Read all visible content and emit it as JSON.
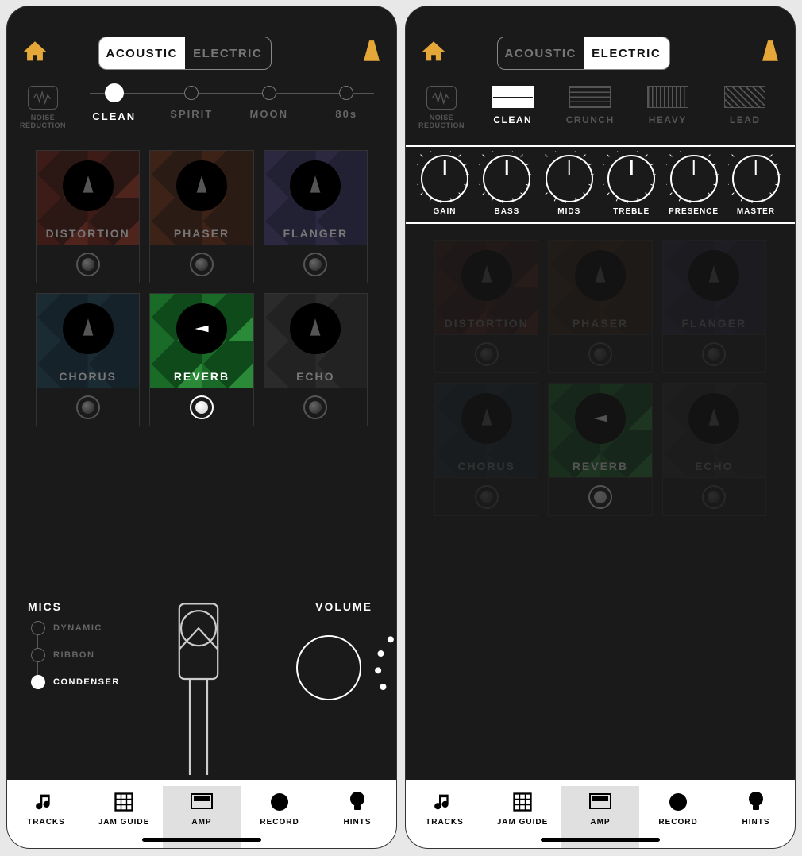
{
  "segmented": {
    "acoustic": "ACOUSTIC",
    "electric": "ELECTRIC"
  },
  "noise": {
    "line1": "NOISE",
    "line2": "REDUCTION"
  },
  "acoustic_steps": [
    {
      "label": "CLEAN",
      "active": true
    },
    {
      "label": "SPIRIT",
      "active": false
    },
    {
      "label": "MOON",
      "active": false
    },
    {
      "label": "80s",
      "active": false
    }
  ],
  "electric_amps": [
    {
      "label": "CLEAN",
      "cls": "clean",
      "active": true
    },
    {
      "label": "CRUNCH",
      "cls": "crunch",
      "active": false
    },
    {
      "label": "HEAVY",
      "cls": "heavy",
      "active": false
    },
    {
      "label": "LEAD",
      "cls": "lead",
      "active": false
    }
  ],
  "amp_knobs": [
    "GAIN",
    "BASS",
    "MIDS",
    "TREBLE",
    "PRESENCE",
    "MASTER"
  ],
  "pedals": [
    {
      "label": "DISTORTION",
      "cls": "distortion",
      "active": false
    },
    {
      "label": "PHASER",
      "cls": "phaser",
      "active": false
    },
    {
      "label": "FLANGER",
      "cls": "flanger",
      "active": false
    },
    {
      "label": "CHORUS",
      "cls": "chorus",
      "active": false
    },
    {
      "label": "REVERB",
      "cls": "reverb",
      "active": true
    },
    {
      "label": "ECHO",
      "cls": "echo",
      "active": false
    }
  ],
  "mics": {
    "title": "MICS",
    "options": [
      {
        "label": "DYNAMIC",
        "active": false
      },
      {
        "label": "RIBBON",
        "active": false
      },
      {
        "label": "CONDENSER",
        "active": true
      }
    ]
  },
  "volume": {
    "title": "VOLUME"
  },
  "tabs": [
    {
      "label": "TRACKS",
      "icon": "music-note"
    },
    {
      "label": "JAM GUIDE",
      "icon": "grid"
    },
    {
      "label": "AMP",
      "icon": "amp",
      "active": true
    },
    {
      "label": "RECORD",
      "icon": "dot"
    },
    {
      "label": "HINTS",
      "icon": "bulb"
    }
  ]
}
